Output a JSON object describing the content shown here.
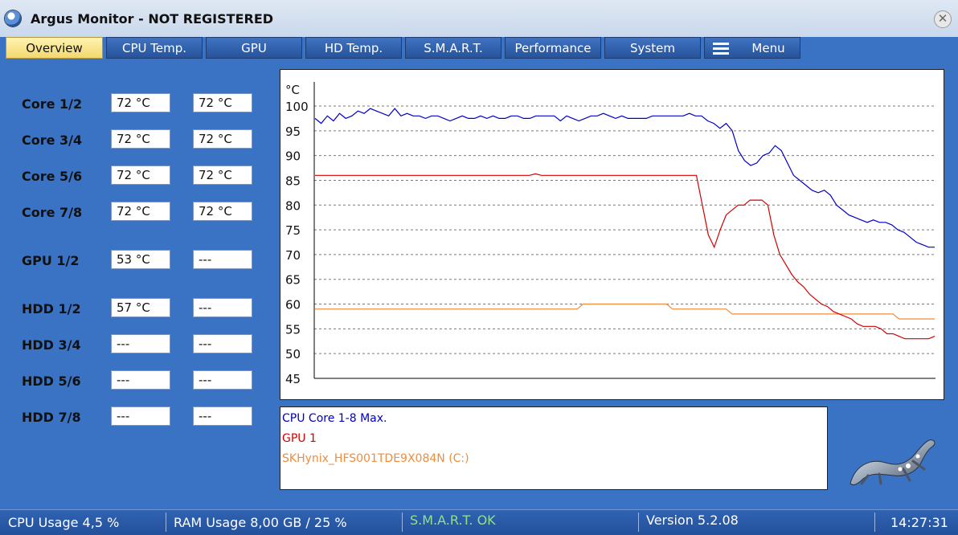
{
  "window": {
    "title": "Argus Monitor - NOT REGISTERED",
    "close_symbol": "✕"
  },
  "tabs": [
    {
      "label": "Overview",
      "active": true
    },
    {
      "label": "CPU Temp.",
      "active": false
    },
    {
      "label": "GPU",
      "active": false
    },
    {
      "label": "HD Temp.",
      "active": false
    },
    {
      "label": "S.M.A.R.T.",
      "active": false
    },
    {
      "label": "Performance",
      "active": false
    },
    {
      "label": "System",
      "active": false
    },
    {
      "label": "Menu",
      "active": false
    }
  ],
  "sensors": [
    {
      "label": "Core 1/2",
      "v1": "72 °C",
      "v2": "72 °C"
    },
    {
      "label": "Core 3/4",
      "v1": "72 °C",
      "v2": "72 °C"
    },
    {
      "label": "Core 5/6",
      "v1": "72 °C",
      "v2": "72 °C"
    },
    {
      "label": "Core 7/8",
      "v1": "72 °C",
      "v2": "72 °C"
    },
    {
      "label": "GPU 1/2",
      "v1": "53 °C",
      "v2": "---"
    },
    {
      "label": "HDD 1/2",
      "v1": "57 °C",
      "v2": "---"
    },
    {
      "label": "HDD 3/4",
      "v1": "---",
      "v2": "---"
    },
    {
      "label": "HDD 5/6",
      "v1": "---",
      "v2": "---"
    },
    {
      "label": "HDD 7/8",
      "v1": "---",
      "v2": "---"
    }
  ],
  "legend": [
    {
      "name": "CPU Core 1-8 Max.",
      "color": "#0000c8"
    },
    {
      "name": "GPU 1",
      "color": "#d40000"
    },
    {
      "name": "SKHynix_HFS001TDE9X084N (C:)",
      "color": "#f08c3c"
    }
  ],
  "chart_data": {
    "type": "line",
    "ylabel": "°C",
    "ylim": [
      45,
      100
    ],
    "yticks": [
      "100",
      "95",
      "90",
      "85",
      "80",
      "75",
      "70",
      "65",
      "60",
      "55",
      "50",
      "45"
    ],
    "grid": "horizontal dashed",
    "series": [
      {
        "name": "CPU Core 1-8 Max.",
        "color": "#0000c8",
        "values": [
          97.5,
          96.5,
          98,
          97,
          98.5,
          97.5,
          98,
          99,
          98.5,
          99.5,
          99,
          98.5,
          98,
          99.5,
          98,
          98.5,
          98,
          98,
          97.5,
          98,
          98,
          97.5,
          97,
          97.5,
          98,
          97.5,
          97.5,
          98,
          97.5,
          98,
          97.5,
          97.5,
          98,
          98,
          97.5,
          97.5,
          98,
          98,
          98,
          98,
          97,
          98,
          97.5,
          97,
          97.5,
          98,
          98,
          98.5,
          98,
          97.5,
          98,
          97.5,
          97.5,
          97.5,
          97.5,
          98,
          98,
          98,
          98,
          98,
          98,
          98.5,
          98,
          98,
          97,
          96.5,
          95.5,
          96.5,
          95,
          91,
          89,
          88,
          88.5,
          90,
          90.5,
          92,
          91,
          88.5,
          86,
          85,
          84,
          83,
          82.5,
          83,
          82,
          80,
          79,
          78,
          77.5,
          77,
          76.5,
          77,
          76.5,
          76.5,
          76,
          75,
          74.5,
          73.5,
          72.5,
          72,
          71.5,
          71.5
        ]
      },
      {
        "name": "GPU 1",
        "color": "#d40000",
        "values": [
          86,
          86,
          86,
          86,
          86,
          86,
          86,
          86,
          86,
          86,
          86,
          86,
          86,
          86,
          86,
          86,
          86,
          86,
          86,
          86,
          86,
          86,
          86,
          86,
          86,
          86,
          86,
          86,
          86,
          86,
          86,
          86,
          86,
          86,
          86,
          86,
          86,
          86.3,
          86,
          86,
          86,
          86,
          86,
          86,
          86,
          86,
          86,
          86,
          86,
          86,
          86,
          86,
          86,
          86,
          86,
          86,
          86,
          86,
          86,
          86,
          86,
          86,
          86,
          86,
          86,
          80,
          74,
          71.5,
          75,
          78,
          79,
          80,
          80,
          81,
          81,
          81,
          80,
          74,
          70,
          68,
          66,
          64.5,
          63.5,
          62,
          61,
          60,
          59.5,
          58.5,
          58,
          57.5,
          57,
          56,
          55.5,
          55.5,
          55.5,
          55,
          54,
          54,
          53.5,
          53,
          53,
          53,
          53,
          53,
          53.5
        ]
      },
      {
        "name": "SKHynix_HFS001TDE9X084N (C:)",
        "color": "#f08c3c",
        "values": [
          59,
          59,
          59,
          59,
          59,
          59,
          59,
          59,
          59,
          59,
          59,
          59,
          59,
          59,
          59,
          59,
          59,
          59,
          59,
          59,
          59,
          59,
          59,
          59,
          59,
          59,
          59,
          59,
          59,
          59,
          59,
          59,
          59,
          59,
          59,
          59,
          59,
          59,
          59,
          59,
          59,
          59,
          59,
          59,
          59,
          60,
          60,
          60,
          60,
          60,
          60,
          60,
          60,
          60,
          60,
          60,
          60,
          60,
          60,
          60,
          59,
          59,
          59,
          59,
          59,
          59,
          59,
          59,
          59,
          59,
          58,
          58,
          58,
          58,
          58,
          58,
          58,
          58,
          58,
          58,
          58,
          58,
          58,
          58,
          58,
          58,
          58,
          58,
          58,
          58,
          58,
          58,
          58,
          58,
          58,
          58,
          58,
          58,
          57,
          57,
          57,
          57,
          57,
          57,
          57
        ]
      }
    ]
  },
  "status": {
    "cpu_usage": "CPU Usage 4,5 %",
    "ram_usage": "RAM Usage 8,00 GB / 25 %",
    "smart": "S.M.A.R.T. OK",
    "version": "Version 5.2.08",
    "time": "14:27:31"
  }
}
